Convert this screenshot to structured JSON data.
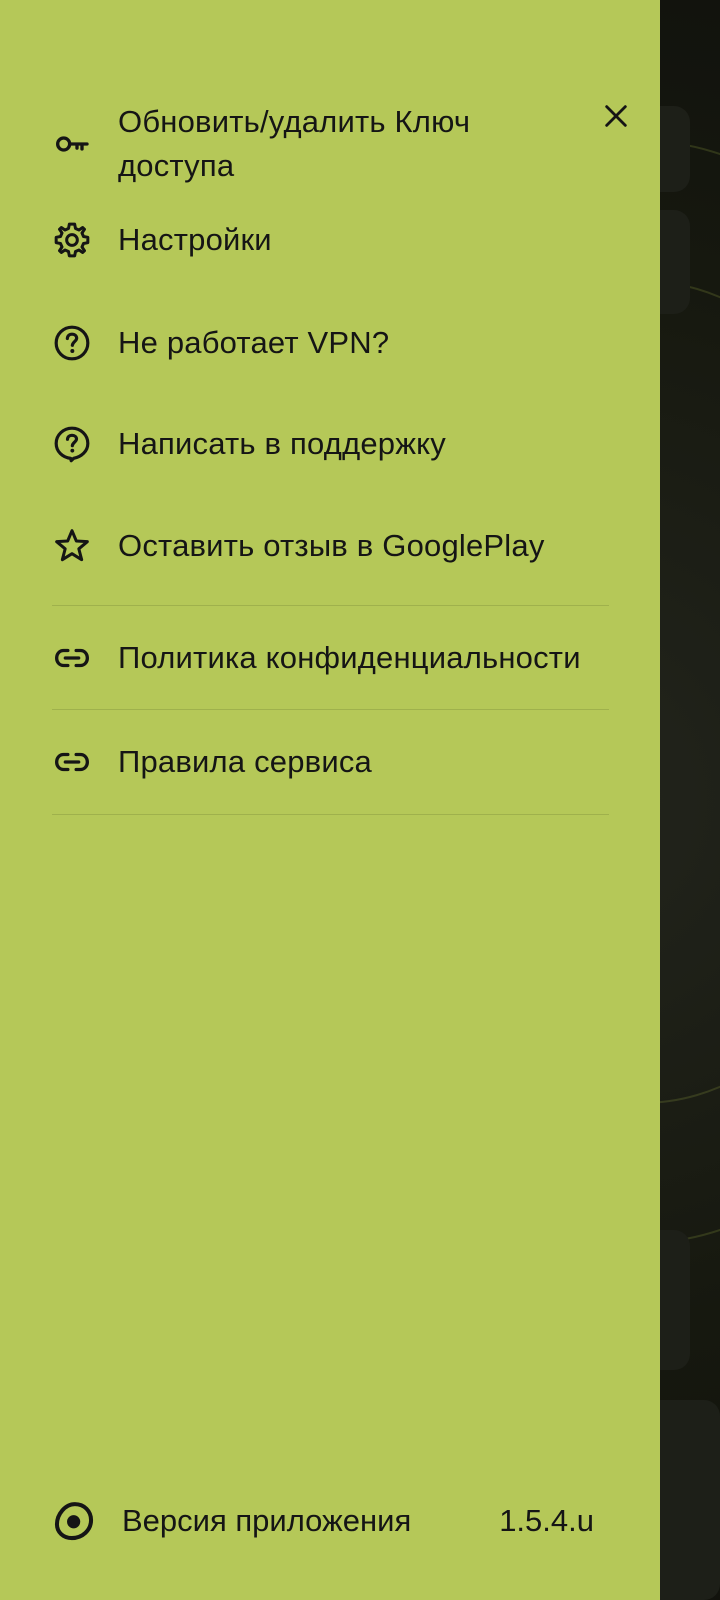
{
  "drawer": {
    "background_color": "#b5c858",
    "close_icon": "close-icon",
    "menu": [
      {
        "icon": "key-icon",
        "label": "Обновить/удалить Ключ доступа"
      },
      {
        "icon": "gear-icon",
        "label": "Настройки"
      },
      {
        "icon": "help-circle-icon",
        "label": "Не работает VPN?"
      },
      {
        "icon": "support-chat-icon",
        "label": "Написать в поддержку"
      },
      {
        "icon": "star-icon",
        "label": "Оставить отзыв в GooglePlay"
      },
      {
        "icon": "link-icon",
        "label": "Политика конфиденциальности"
      },
      {
        "icon": "link-icon",
        "label": "Правила сервиса"
      }
    ],
    "footer": {
      "icon": "app-logo-icon",
      "label": "Версия приложения",
      "version": "1.5.4.u"
    }
  }
}
